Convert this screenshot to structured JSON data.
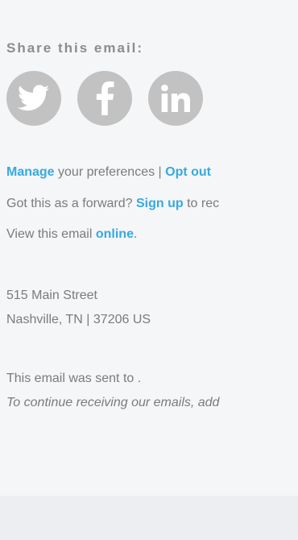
{
  "share": {
    "heading": "Share this email:",
    "icons": [
      "twitter-icon",
      "facebook-icon",
      "linkedin-icon"
    ],
    "icon_color": "#c2c2c2"
  },
  "links": {
    "manage": "Manage",
    "preferences_text": " your preferences | ",
    "opt_out": "Opt out",
    "forward_text": "Got this as a forward? ",
    "sign_up": "Sign up",
    "sign_up_suffix": " to rec",
    "view_text": "View this email ",
    "online": "online",
    "online_suffix": ".",
    "link_color": "#37a9e0"
  },
  "address": {
    "street": "515 Main Street",
    "city_line": "Nashville, TN | 37206 US"
  },
  "notice": {
    "sent_to": "This email was sent to .",
    "continue_text": "To continue receiving our emails, add"
  }
}
